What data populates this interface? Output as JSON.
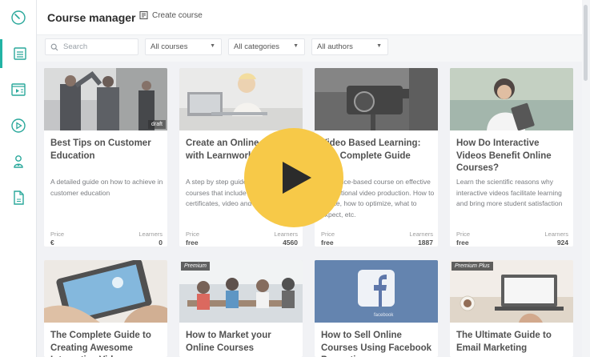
{
  "header": {
    "title": "Course manager",
    "create_label": "Create course"
  },
  "filters": {
    "search_placeholder": "Search",
    "courses": "All courses",
    "categories": "All categories",
    "authors": "All authors"
  },
  "labels": {
    "price": "Price",
    "learners": "Learners"
  },
  "sidebar": {
    "items": [
      {
        "icon": "dashboard-gauge-icon"
      },
      {
        "icon": "course-list-icon",
        "active": true
      },
      {
        "icon": "video-presentation-icon"
      },
      {
        "icon": "play-circle-icon"
      },
      {
        "icon": "learner-person-icon"
      },
      {
        "icon": "document-icon"
      }
    ]
  },
  "courses": [
    {
      "title": "Best Tips on Customer Education",
      "desc": "A detailed guide on how to achieve in customer education",
      "price": "€",
      "learners": "0",
      "badge": "draft"
    },
    {
      "title": "Create an Online Course with Learnworlds",
      "desc": "A step by step guide on how to create courses that include ebooks, tests, certificates, video and a lot more...",
      "price": "free",
      "learners": "4560",
      "badge": ""
    },
    {
      "title": "Video Based Learning: The Complete Guide",
      "desc": "A practice-based course on effective instructional video production. How to create, how to optimize, what to expect, etc.",
      "price": "free",
      "learners": "1887",
      "badge": ""
    },
    {
      "title": "How Do Interactive Videos Benefit Online Courses?",
      "desc": "Learn the scientific reasons why interactive videos facilitate learning and bring more student satisfaction",
      "price": "free",
      "learners": "924",
      "badge": ""
    },
    {
      "title": "The Complete Guide to Creating Awesome Interactive Videos",
      "desc": "",
      "price": "",
      "learners": "",
      "badge": ""
    },
    {
      "title": "How to Market your Online Courses",
      "desc": "",
      "price": "",
      "learners": "",
      "badge": "Premium"
    },
    {
      "title": "How to Sell Online Courses Using Facebook Promotion",
      "desc": "",
      "price": "",
      "learners": "",
      "badge": ""
    },
    {
      "title": "The Ultimate Guide to Email Marketing",
      "desc": "",
      "price": "",
      "learners": "",
      "badge": "Premium Plus"
    }
  ],
  "colors": {
    "accent": "#22b3a4",
    "play_button": "#f7c948"
  }
}
